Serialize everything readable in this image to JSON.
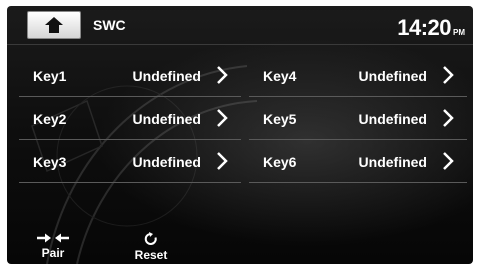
{
  "header": {
    "title": "SWC",
    "time": "14:20",
    "ampm": "PM"
  },
  "keys": [
    {
      "label": "Key1",
      "value": "Undefined"
    },
    {
      "label": "Key2",
      "value": "Undefined"
    },
    {
      "label": "Key3",
      "value": "Undefined"
    },
    {
      "label": "Key4",
      "value": "Undefined"
    },
    {
      "label": "Key5",
      "value": "Undefined"
    },
    {
      "label": "Key6",
      "value": "Undefined"
    }
  ],
  "bottom": {
    "pair_label": "Pair",
    "reset_label": "Reset"
  },
  "icons": {
    "home": "home-icon",
    "chevron": "chevron-right-icon",
    "pair": "pair-arrows-icon",
    "reset": "reset-icon"
  }
}
